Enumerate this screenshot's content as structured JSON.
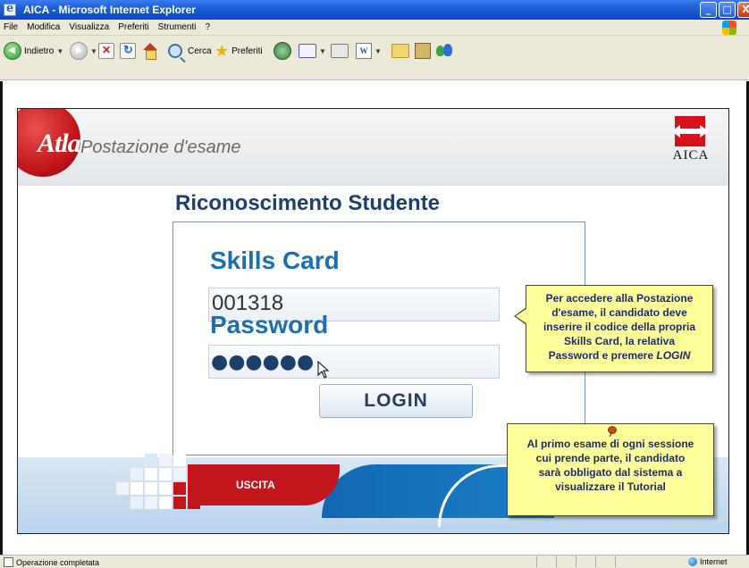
{
  "window": {
    "title": "AICA - Microsoft Internet Explorer",
    "buttons": {
      "minimize": "_",
      "maximize": "□",
      "close": "X"
    }
  },
  "menubar": {
    "items": [
      "File",
      "Modifica",
      "Visualizza",
      "Preferiti",
      "Strumenti",
      "?"
    ]
  },
  "toolbar": {
    "back_label": "Indietro",
    "search_label": "Cerca",
    "favorites_label": "Preferiti",
    "word_label": "W"
  },
  "app": {
    "brand_logo_text": "Atlas",
    "brand_subtitle": "Postazione d'esame",
    "aica_logo_text": "AICA",
    "page_title": "Riconoscimento Studente",
    "skills_card_label": "Skills Card",
    "skills_card_value": "001318",
    "password_label": "Password",
    "password_masked": "●●●●●●",
    "login_button": "LOGIN",
    "exit_button": "USCITA"
  },
  "callouts": {
    "login_hint": {
      "lines": [
        "Per accedere alla Postazione",
        "d'esame, il candidato deve",
        "inserire il codice della propria",
        "Skills Card, la relativa",
        "Password e premere"
      ],
      "emphasis": "LOGIN"
    },
    "tutorial_hint": {
      "lines": [
        "Al primo esame di ogni sessione",
        "cui prende parte, il candidato",
        "sarà obbligato dal sistema a",
        "visualizzare  il Tutorial"
      ]
    }
  },
  "statusbar": {
    "status_text": "Operazione completata",
    "zone_text": "Internet"
  },
  "colors": {
    "title_blue": "#1d3f6e",
    "label_blue": "#1b6fb0",
    "atlas_red": "#c3161c",
    "callout_yellow": "#ffff9a",
    "callout_text": "#1a2a6e"
  }
}
